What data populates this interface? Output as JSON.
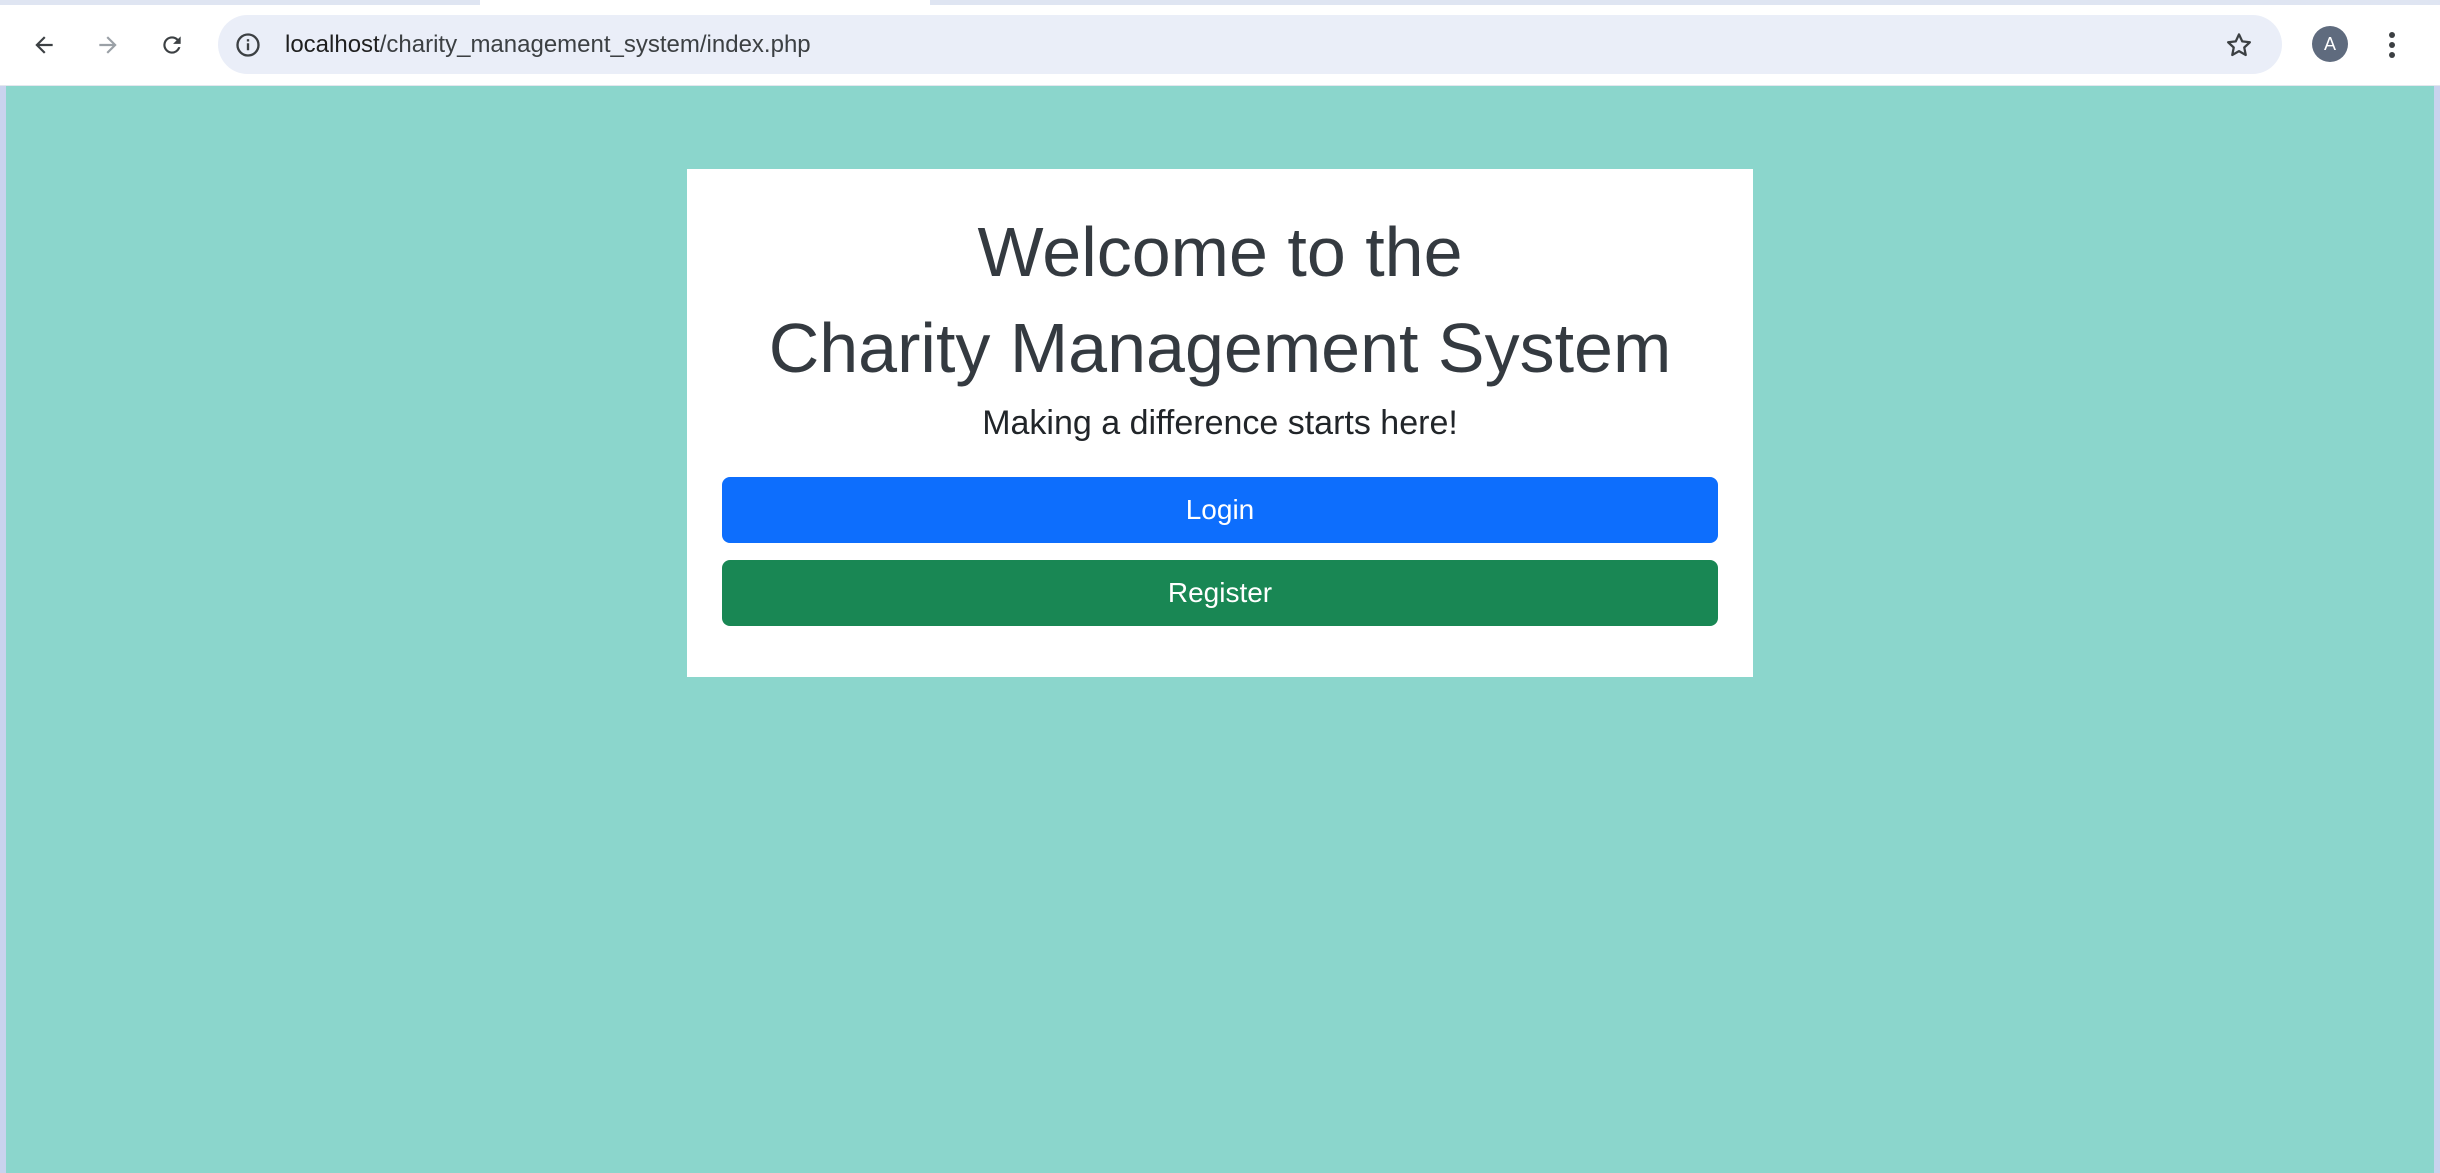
{
  "browser": {
    "url_host": "localhost",
    "url_path": "/charity_management_system/index.php",
    "profile_initial": "A",
    "icons": {
      "back": "arrow-left-icon",
      "forward": "arrow-right-icon",
      "reload": "reload-icon",
      "site_info": "info-icon",
      "bookmark": "star-icon",
      "menu": "vertical-dots-icon"
    }
  },
  "page": {
    "background_color": "#8bd6cc",
    "title_line1": "Welcome to the",
    "title_line2": "Charity Management System",
    "subtitle": "Making a difference starts here!",
    "login_label": "Login",
    "register_label": "Register",
    "login_color": "#0d6efd",
    "register_color": "#198754"
  }
}
